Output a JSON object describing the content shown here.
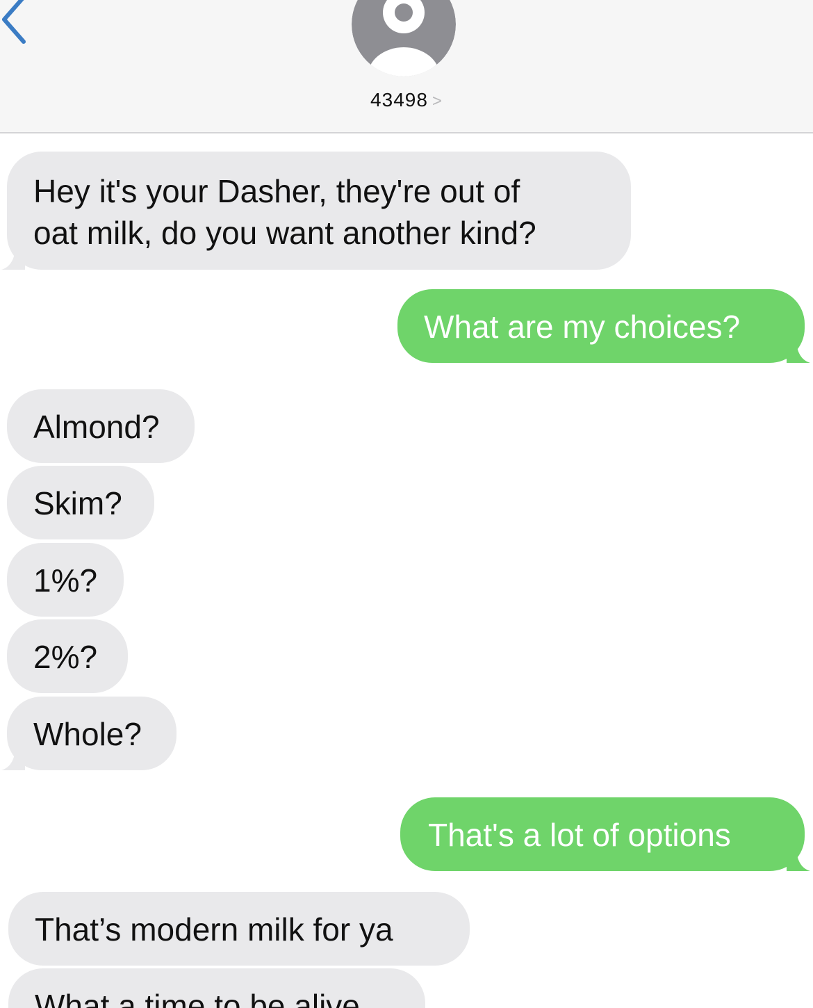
{
  "header": {
    "back_icon": "chevron-left-icon",
    "avatar_icon": "person-silhouette-icon",
    "contact_name": "43498",
    "contact_chevron": ">"
  },
  "colors": {
    "header_bg": "#f6f6f6",
    "received_bubble": "#e9e9eb",
    "sent_bubble": "#6fd46a",
    "back_icon": "#3b7cc4",
    "avatar": "#8e8e93"
  },
  "messages": [
    {
      "sender": "them",
      "text_lines": [
        "Hey it's your Dasher, they're out of",
        "oat milk, do you want another kind?"
      ]
    },
    {
      "sender": "me",
      "text": "What are my choices?"
    },
    {
      "sender": "them",
      "text": "Almond?"
    },
    {
      "sender": "them",
      "text": "Skim?"
    },
    {
      "sender": "them",
      "text": "1%?"
    },
    {
      "sender": "them",
      "text": "2%?"
    },
    {
      "sender": "them",
      "text": "Whole?"
    },
    {
      "sender": "me",
      "text": "That's a lot of options"
    },
    {
      "sender": "them",
      "text": "That’s modern milk for ya"
    },
    {
      "sender": "them",
      "text": "What a time to be alive"
    }
  ]
}
